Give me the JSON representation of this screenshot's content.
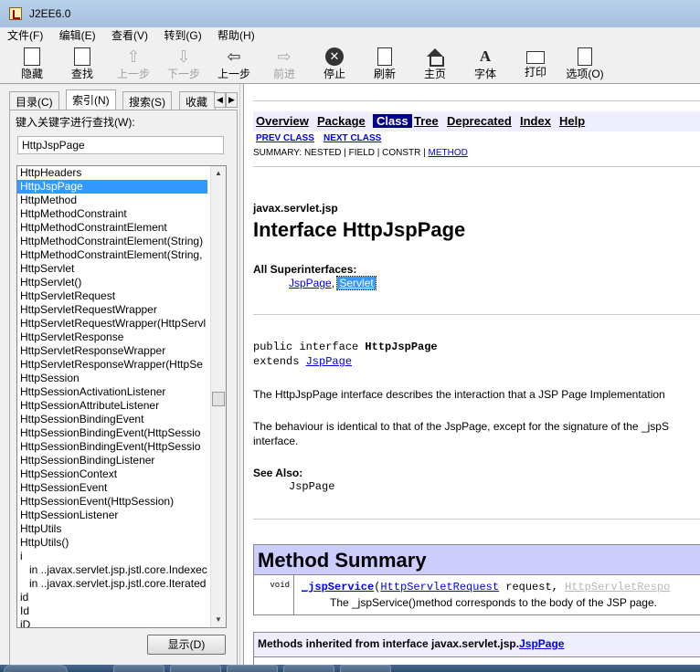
{
  "window": {
    "title": "J2EE6.0"
  },
  "menu": [
    "文件(F)",
    "编辑(E)",
    "查看(V)",
    "转到(G)",
    "帮助(H)"
  ],
  "toolbar": [
    {
      "label": "隐藏",
      "icon": "hide-icon",
      "enabled": true
    },
    {
      "label": "查找",
      "icon": "find-icon",
      "enabled": true
    },
    {
      "label": "上一步",
      "icon": "up-arrow-icon",
      "enabled": false
    },
    {
      "label": "下一步",
      "icon": "down-arrow-icon",
      "enabled": false
    },
    {
      "label": "上一步",
      "icon": "back-arrow-icon",
      "enabled": true
    },
    {
      "label": "前进",
      "icon": "forward-arrow-icon",
      "enabled": false
    },
    {
      "label": "停止",
      "icon": "stop-icon",
      "enabled": true
    },
    {
      "label": "刷新",
      "icon": "refresh-icon",
      "enabled": true
    },
    {
      "label": "主页",
      "icon": "home-icon",
      "enabled": true
    },
    {
      "label": "字体",
      "icon": "font-icon",
      "enabled": true
    },
    {
      "label": "打印",
      "icon": "print-icon",
      "enabled": true
    },
    {
      "label": "选项(O)",
      "icon": "options-icon",
      "enabled": true
    }
  ],
  "left": {
    "tabs": [
      "目录(C)",
      "索引(N)",
      "搜索(S)",
      "收藏"
    ],
    "active_tab": "索引(N)",
    "keyword_label": "键入关键字进行查找(W):",
    "keyword_value": "HttpJspPage",
    "selected": "HttpJspPage",
    "items": [
      "HttpHeaders",
      "HttpJspPage",
      "HttpMethod",
      "HttpMethodConstraint",
      "HttpMethodConstraintElement",
      "HttpMethodConstraintElement(String)",
      "HttpMethodConstraintElement(String,",
      "HttpServlet",
      "HttpServlet()",
      "HttpServletRequest",
      "HttpServletRequestWrapper",
      "HttpServletRequestWrapper(HttpServl",
      "HttpServletResponse",
      "HttpServletResponseWrapper",
      "HttpServletResponseWrapper(HttpSe",
      "HttpSession",
      "HttpSessionActivationListener",
      "HttpSessionAttributeListener",
      "HttpSessionBindingEvent",
      "HttpSessionBindingEvent(HttpSessio",
      "HttpSessionBindingEvent(HttpSessio",
      "HttpSessionBindingListener",
      "HttpSessionContext",
      "HttpSessionEvent",
      "HttpSessionEvent(HttpSession)",
      "HttpSessionListener",
      "HttpUtils",
      "HttpUtils()",
      "i",
      "in ..javax.servlet.jsp.jstl.core.Indexec",
      "in ..javax.servlet.jsp.jstl.core.Iterated",
      "id",
      "Id",
      "iD"
    ],
    "sub_items": [
      29,
      30
    ],
    "show_button": "显示(D)"
  },
  "doc": {
    "nav": [
      "Overview",
      "Package",
      "Class",
      "Tree",
      "Deprecated",
      "Index",
      "Help"
    ],
    "current_nav": "Class",
    "prev_class": "PREV CLASS",
    "next_class": "NEXT CLASS",
    "summary_prefix": "SUMMARY: NESTED | FIELD | CONSTR | ",
    "summary_method": "METHOD",
    "package": "javax.servlet.jsp",
    "heading": "Interface HttpJspPage",
    "superinterfaces_label": "All Superinterfaces:",
    "superinterface_1": "JspPage",
    "superinterface_sep": ", ",
    "superinterface_2": "Servlet",
    "decl_public": "public interface ",
    "decl_name": "HttpJspPage",
    "decl_extends": "extends ",
    "decl_extends_link": "JspPage",
    "desc1": "The HttpJspPage interface describes the interaction that a JSP Page Implementation",
    "desc2a": "The behaviour is identical to that of the JspPage, except for the signature of the _jspS",
    "desc2b": "interface.",
    "see_also_label": "See Also:",
    "see_also_value": "JspPage",
    "method_summary_title": "Method Summary",
    "method_return": "void",
    "method_name": "_jspService",
    "method_open": "(",
    "method_param1_type": "HttpServletRequest",
    "method_param1_name": " request, ",
    "method_param2_type": "HttpServletRespo",
    "method_desc": "The _jspService()method corresponds to the body of the JSP page.",
    "inherited_prefix": "Methods inherited from interface javax.servlet.jsp.",
    "inherited_link": "JspPage"
  }
}
